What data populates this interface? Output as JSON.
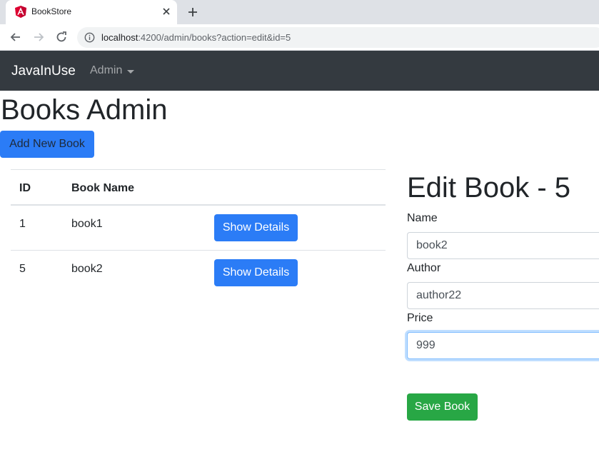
{
  "browser": {
    "tab_title": "BookStore",
    "url_host": "localhost",
    "url_path": ":4200/admin/books?action=edit&id=5"
  },
  "navbar": {
    "brand": "JavaInUse",
    "admin_menu": "Admin"
  },
  "page": {
    "title": "Books Admin",
    "add_button": "Add New Book"
  },
  "table": {
    "headers": [
      "ID",
      "Book Name"
    ],
    "rows": [
      {
        "id": "1",
        "name": "book1",
        "action": "Show Details"
      },
      {
        "id": "5",
        "name": "book2",
        "action": "Show Details"
      }
    ]
  },
  "edit_form": {
    "title": "Edit Book - 5",
    "name_label": "Name",
    "name_value": "book2",
    "author_label": "Author",
    "author_value": "author22",
    "price_label": "Price",
    "price_value": "999",
    "save_button": "Save Book"
  },
  "colors": {
    "navbar_bg": "#343a40",
    "primary": "#2b7cf6",
    "success": "#28a745"
  },
  "icons": [
    "angular-icon",
    "close-icon",
    "plus-icon",
    "back-arrow-icon",
    "forward-arrow-icon",
    "reload-icon",
    "info-icon",
    "caret-down-icon"
  ]
}
